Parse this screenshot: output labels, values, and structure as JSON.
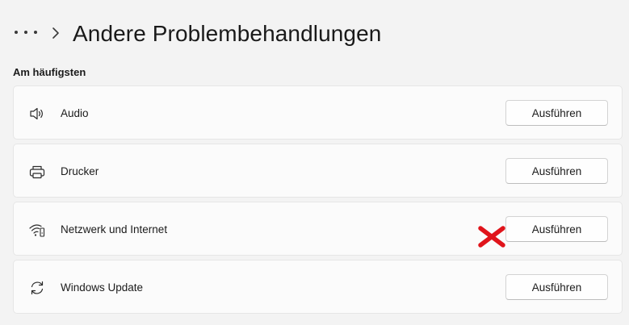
{
  "header": {
    "title": "Andere Problembehandlungen",
    "more_icon": "more-horizontal-icon",
    "chevron_icon": "chevron-right-icon"
  },
  "section": {
    "title": "Am häufigsten"
  },
  "items": [
    {
      "label": "Audio",
      "icon": "speaker-icon",
      "button_label": "Ausführen"
    },
    {
      "label": "Drucker",
      "icon": "printer-icon",
      "button_label": "Ausführen"
    },
    {
      "label": "Netzwerk und Internet",
      "icon": "network-icon",
      "button_label": "Ausführen"
    },
    {
      "label": "Windows Update",
      "icon": "sync-icon",
      "button_label": "Ausführen"
    }
  ],
  "annotation": {
    "icon": "red-cross-mark",
    "color": "#e0141b"
  },
  "colors": {
    "background": "#f3f3f3",
    "card": "#fbfbfb",
    "card_border": "#e6e6e6",
    "text": "#1b1b1b"
  }
}
